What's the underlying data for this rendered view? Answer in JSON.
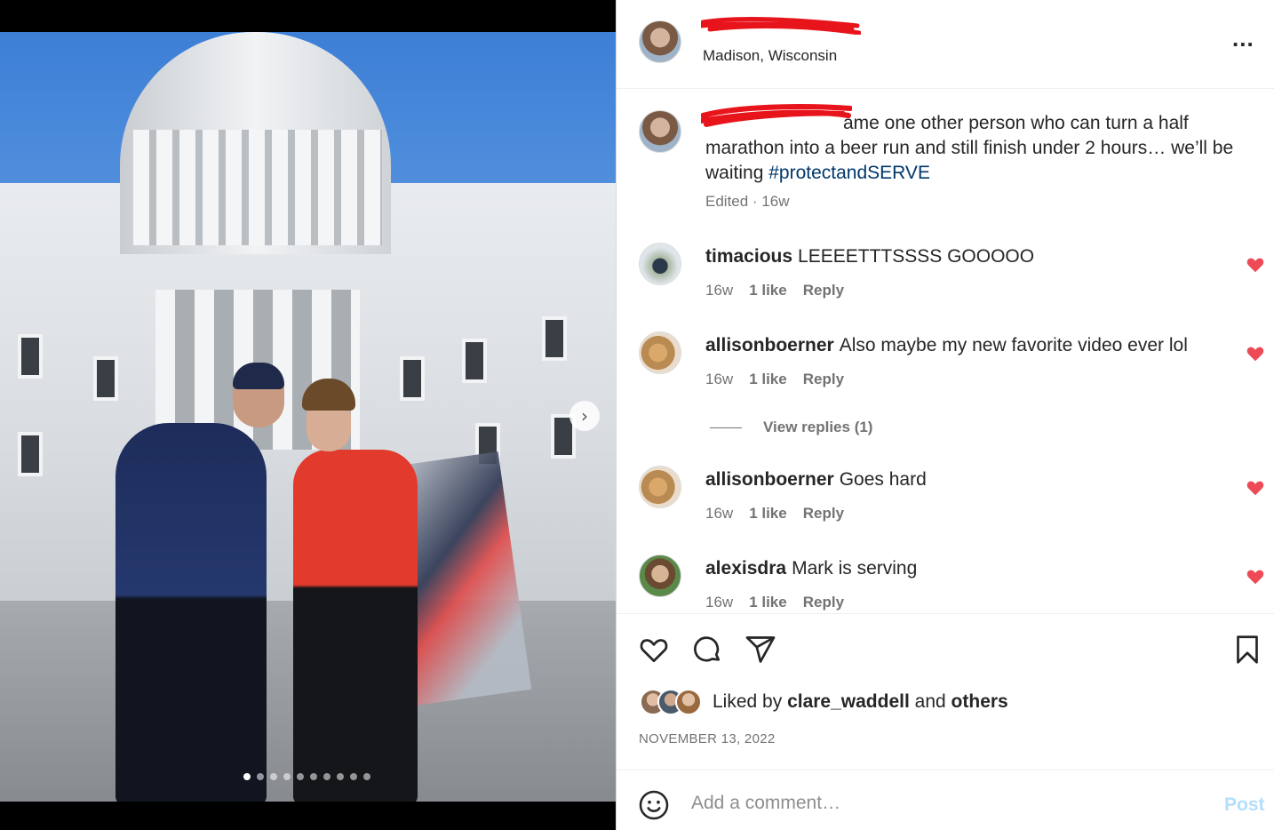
{
  "header": {
    "location": "Madison, Wisconsin",
    "more_label": "...",
    "username_redacted": true
  },
  "caption": {
    "visible_text": "ame one other person who can turn a half marathon into a beer run and still finish under 2 hours… we’ll be waiting",
    "hashtag": "#protectandSERVE",
    "meta": "Edited · 16w"
  },
  "comments": [
    {
      "user": "timacious",
      "text": "LEEEETTTSSSS GOOOOO",
      "age": "16w",
      "likes": "1 like",
      "reply": "Reply"
    },
    {
      "user": "allisonboerner",
      "text": "Also maybe my new favorite video ever lol",
      "age": "16w",
      "likes": "1 like",
      "reply": "Reply"
    },
    {
      "user": "allisonboerner",
      "text": "Goes hard",
      "age": "16w",
      "likes": "1 like",
      "reply": "Reply"
    },
    {
      "user": "alexisdra",
      "text": "Mark is serving",
      "age": "16w",
      "likes": "1 like",
      "reply": "Reply"
    }
  ],
  "view_replies": "View replies (1)",
  "likes": {
    "prefix": "Liked by",
    "user": "clare_waddell",
    "and": "and",
    "others": "others"
  },
  "date": "NOVEMBER 13, 2022",
  "add_comment": {
    "placeholder": "Add a comment…",
    "post_label": "Post"
  },
  "media": {
    "next_glyph": "›",
    "carousel_total": 10,
    "carousel_active": 1
  },
  "colors": {
    "heart_red": "#ed4956",
    "link_blue": "#00376b",
    "post_disabled": "#b2dffc",
    "redaction": "#e8141c"
  },
  "icons": [
    "heart-icon",
    "comment-icon",
    "share-icon",
    "bookmark-icon",
    "emoji-icon",
    "more-icon",
    "chevron-right-icon"
  ]
}
